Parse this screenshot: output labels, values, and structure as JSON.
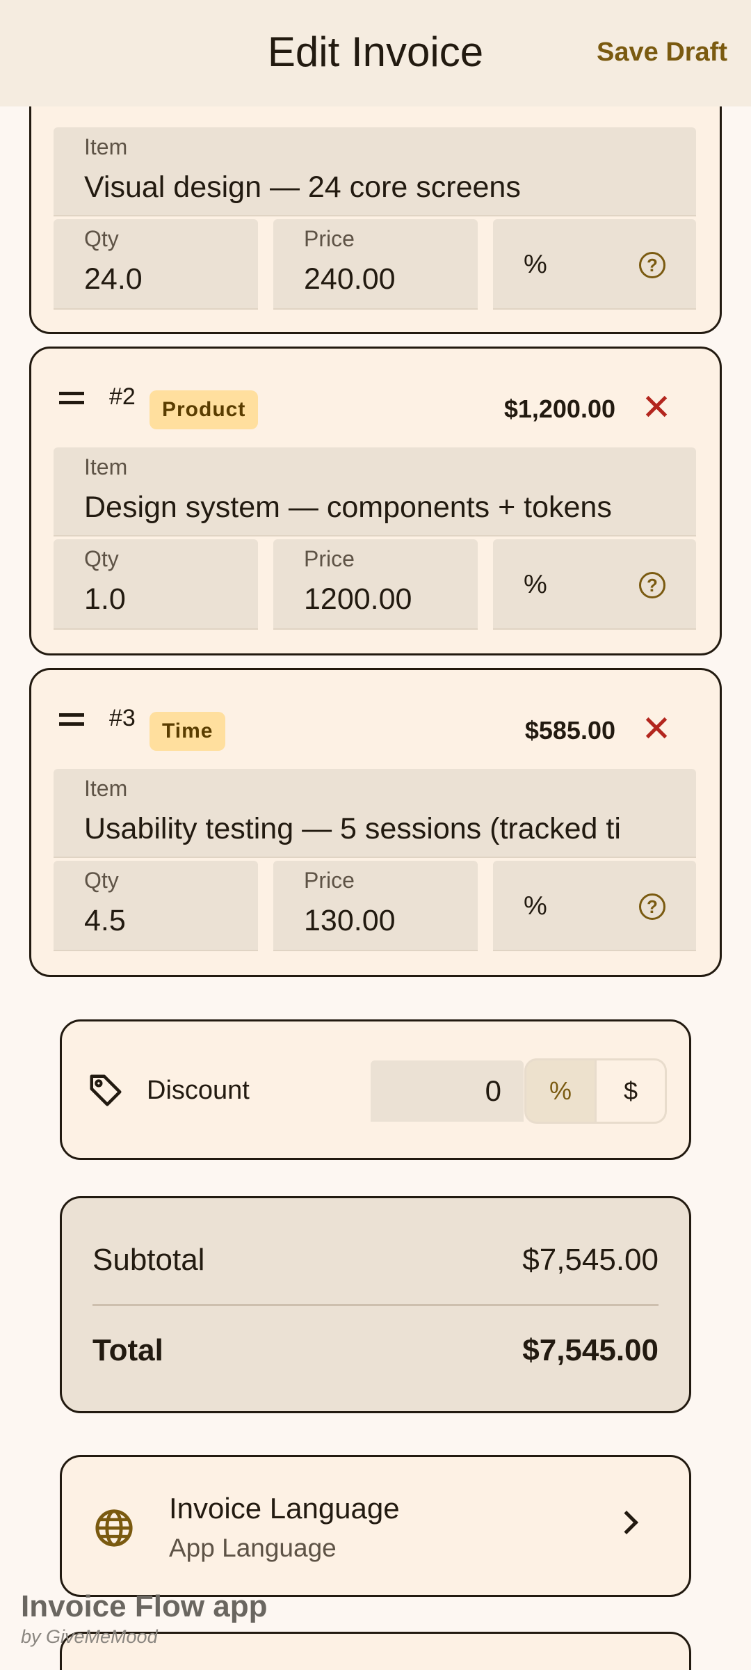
{
  "appbar": {
    "title": "Edit Invoice",
    "action_label": "Save Draft"
  },
  "line_items": [
    {
      "number": "",
      "type": "",
      "total": "",
      "item_label": "Item",
      "item_value": "Visual design — 24 core screens",
      "qty_label": "Qty",
      "qty_value": "24.0",
      "price_label": "Price",
      "price_value": "240.00",
      "pct_symbol": "%"
    },
    {
      "number": "#2",
      "type": "Product",
      "total": "$1,200.00",
      "item_label": "Item",
      "item_value": "Design system — components + tokens",
      "qty_label": "Qty",
      "qty_value": "1.0",
      "price_label": "Price",
      "price_value": "1200.00",
      "pct_symbol": "%"
    },
    {
      "number": "#3",
      "type": "Time",
      "total": "$585.00",
      "item_label": "Item",
      "item_value": "Usability testing — 5 sessions (tracked ti",
      "qty_label": "Qty",
      "qty_value": "4.5",
      "price_label": "Price",
      "price_value": "130.00",
      "pct_symbol": "%"
    }
  ],
  "discount": {
    "label": "Discount",
    "value": "0",
    "options": [
      "%",
      "$"
    ],
    "selected": "%"
  },
  "totals": {
    "subtotal_label": "Subtotal",
    "subtotal_value": "$7,545.00",
    "total_label": "Total",
    "total_value": "$7,545.00"
  },
  "language": {
    "title": "Invoice Language",
    "subtitle": "App Language"
  },
  "watermark": {
    "title": "Invoice Flow app",
    "subtitle": "by GiveMeMood"
  },
  "icons": {
    "drag": "drag-handle-icon",
    "remove": "close-icon",
    "help": "help-icon",
    "discount": "tag-icon",
    "language": "globe-icon",
    "chevron": "chevron-right-icon"
  },
  "colors": {
    "background": "#fdf7f2",
    "card": "#fdf1e4",
    "field": "#ebe1d4",
    "accent": "#7a5a10",
    "chip": "#ffdf9e",
    "remove": "#b3261e"
  }
}
